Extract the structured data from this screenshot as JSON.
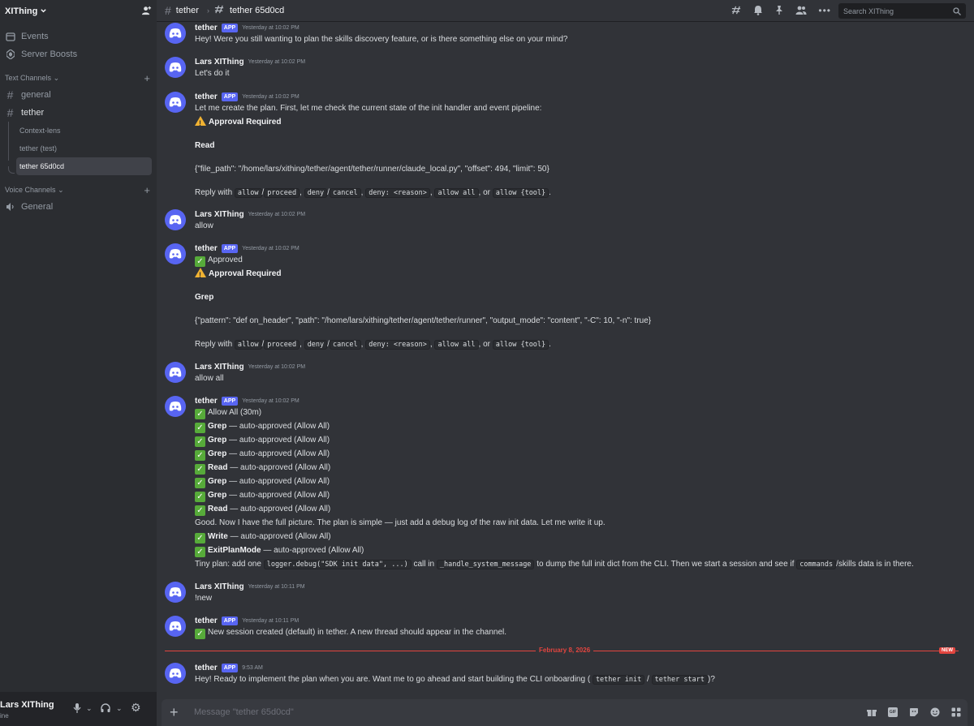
{
  "server": {
    "name": "XIThing"
  },
  "sidebar": {
    "top_items": [
      {
        "label": "Events",
        "icon": "calendar-icon"
      },
      {
        "label": "Server Boosts",
        "icon": "boost-icon"
      }
    ],
    "text_category": "Text Channels",
    "channels": [
      {
        "label": "general"
      },
      {
        "label": "tether"
      }
    ],
    "threads": [
      {
        "label": "Context-lens"
      },
      {
        "label": "tether (test)"
      },
      {
        "label": "tether 65d0cd"
      }
    ],
    "voice_category": "Voice Channels",
    "voice_channels": [
      {
        "label": "General"
      }
    ]
  },
  "user_panel": {
    "name": "Lars XIThing",
    "status": "ine"
  },
  "header": {
    "channel": "tether",
    "thread": "tether 65d0cd",
    "search_placeholder": "Search XIThing"
  },
  "messages": {
    "m1": {
      "author": "tether",
      "tag": "APP",
      "time": "Yesterday at 10:02 PM",
      "text": "Hey! Were you still wanting to plan the skills discovery feature, or is there something else on your mind?"
    },
    "m2": {
      "author": "Lars XIThing",
      "time": "Yesterday at 10:02 PM",
      "text": "Let's do it"
    },
    "m3": {
      "author": "tether",
      "tag": "APP",
      "time": "Yesterday at 10:02 PM",
      "intro": "Let me create the plan. First, let me check the current state of the init handler and event pipeline:",
      "approval": "Approval Required",
      "tool": "Read",
      "args": "{\"file_path\": \"/home/lars/xithing/tether/agent/tether/runner/claude_local.py\", \"offset\": 494, \"limit\": 50}",
      "reply_with": "Reply with",
      "c_allow": "allow",
      "c_proceed": "proceed",
      "c_deny": "deny",
      "c_cancel": "cancel",
      "c_deny_reason": "deny: <reason>",
      "c_allow_all": "allow all",
      "c_allow_tool": "allow {tool}",
      "or": ", or",
      "slash": "/",
      "comma": ",",
      "period": "."
    },
    "m4": {
      "author": "Lars XIThing",
      "time": "Yesterday at 10:02 PM",
      "text": "allow"
    },
    "m5": {
      "author": "tether",
      "tag": "APP",
      "time": "Yesterday at 10:02 PM",
      "approved": "Approved",
      "approval": "Approval Required",
      "tool": "Grep",
      "args": "{\"pattern\": \"def on_header\", \"path\": \"/home/lars/xithing/tether/agent/tether/runner\", \"output_mode\": \"content\", \"-C\": 10, \"-n\": true}"
    },
    "m6": {
      "author": "Lars XIThing",
      "time": "Yesterday at 10:02 PM",
      "text": "allow all"
    },
    "m7": {
      "author": "tether",
      "tag": "APP",
      "time": "Yesterday at 10:02 PM",
      "allow_all": "Allow All (30m)",
      "auto_suffix": "— auto-approved (Allow All)",
      "auto_tools": [
        "Grep",
        "Grep",
        "Grep",
        "Read",
        "Grep",
        "Grep",
        "Read"
      ],
      "summary": "Good. Now I have the full picture. The plan is simple — just add a debug log of the raw init data. Let me write it up.",
      "write_tool": "Write",
      "exit_tool": "ExitPlanMode",
      "plan_a": "Tiny plan: add one",
      "plan_code1": "logger.debug(\"SDK init data\", ...)",
      "plan_b": "call in",
      "plan_code2": "_handle_system_message",
      "plan_c": "to dump the full init dict from the CLI. Then we start a session and see if",
      "plan_code3": "commands",
      "plan_d": "/skills data is in there."
    },
    "m8": {
      "author": "Lars XIThing",
      "time": "Yesterday at 10:11 PM",
      "text": "!new"
    },
    "m9": {
      "author": "tether",
      "tag": "APP",
      "time": "Yesterday at 10:11 PM",
      "text": "New session created (default) in tether. A new thread should appear in the channel."
    },
    "divider": {
      "date": "February 8, 2026",
      "badge": "NEW"
    },
    "m10": {
      "author": "tether",
      "tag": "APP",
      "time": "9:53 AM",
      "text_a": "Hey! Ready to implement the plan when you are. Want me to go ahead and start building the CLI onboarding (",
      "code1": "tether init",
      "sep": "/",
      "code2": "tether start",
      "text_b": ")?"
    }
  },
  "composer": {
    "placeholder": "Message \"tether 65d0cd\""
  },
  "colors": {
    "accent": "#5865f2",
    "new_divider": "#e2453f",
    "check": "#57ab3a",
    "warning": "#f0b232"
  }
}
